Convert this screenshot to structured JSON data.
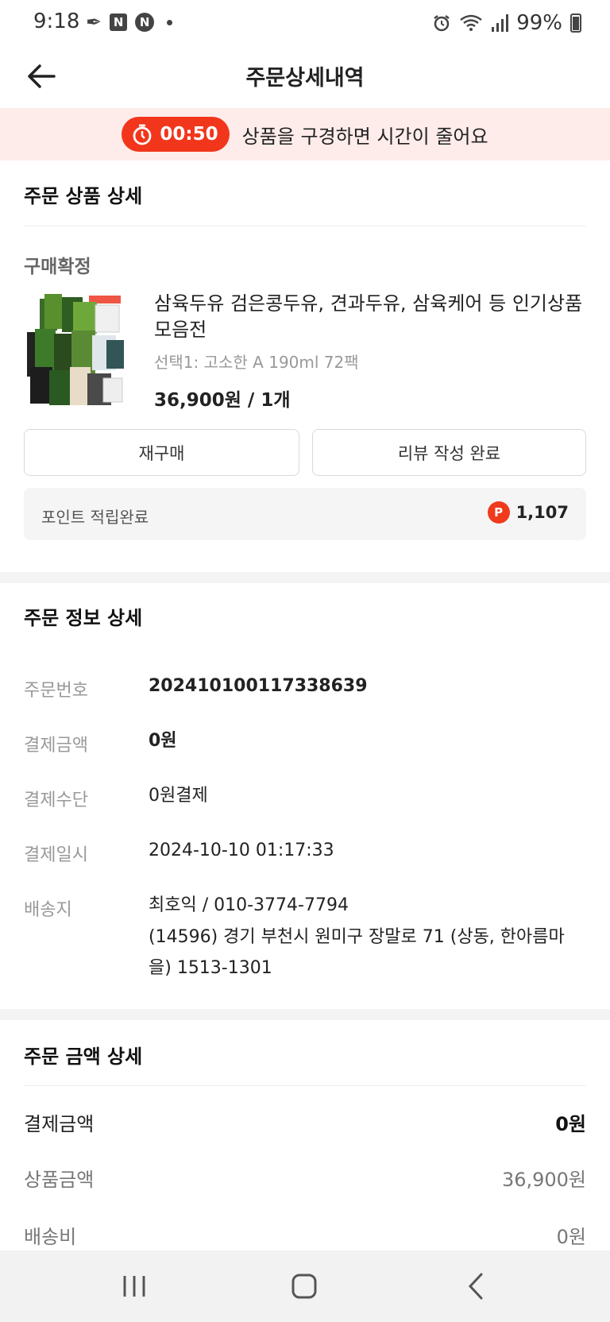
{
  "status_bar": {
    "time": "9:18",
    "battery": "99%"
  },
  "header": {
    "title": "주문상세내역"
  },
  "timer_banner": {
    "time": "00:50",
    "message": "상품을 구경하면 시간이 줄어요"
  },
  "order_product": {
    "section_title": "주문 상품 상세",
    "status": "구매확정",
    "product_name": "삼육두유 검은콩두유, 견과두유, 삼육케어 등 인기상품 모음전",
    "option": "선택1: 고소한 A 190ml 72팩",
    "price_qty": "36,900원 / 1개",
    "rebuy_label": "재구매",
    "review_label": "리뷰 작성 완료",
    "points_label": "포인트 적립완료",
    "points_icon_letter": "P",
    "points_value": "1,107"
  },
  "order_info": {
    "section_title": "주문 정보 상세",
    "rows": [
      {
        "label": "주문번호",
        "value": "20241010011733863 9"
      },
      {
        "label": "결제금액",
        "value": "0원"
      },
      {
        "label": "결제수단",
        "value": "0원결제"
      },
      {
        "label": "결제일시",
        "value": "2024-10-10 01:17:33"
      },
      {
        "label": "배송지",
        "value": "최호익 / 010-3774-7794"
      }
    ],
    "address_line1": "(14596) 경기 부천시 원미구 장말로 71 (상동, 한아름마",
    "address_line2": "을) 1513-1301"
  },
  "order_amount": {
    "section_title": "주문 금액 상세",
    "rows": [
      {
        "label": "결제금액",
        "value": "0원"
      },
      {
        "label": "상품금액",
        "value": "36,900원"
      },
      {
        "label": "배송비",
        "value": "0원"
      }
    ]
  },
  "colors": {
    "accent": "#f2361c",
    "banner_bg": "#fdecea"
  }
}
